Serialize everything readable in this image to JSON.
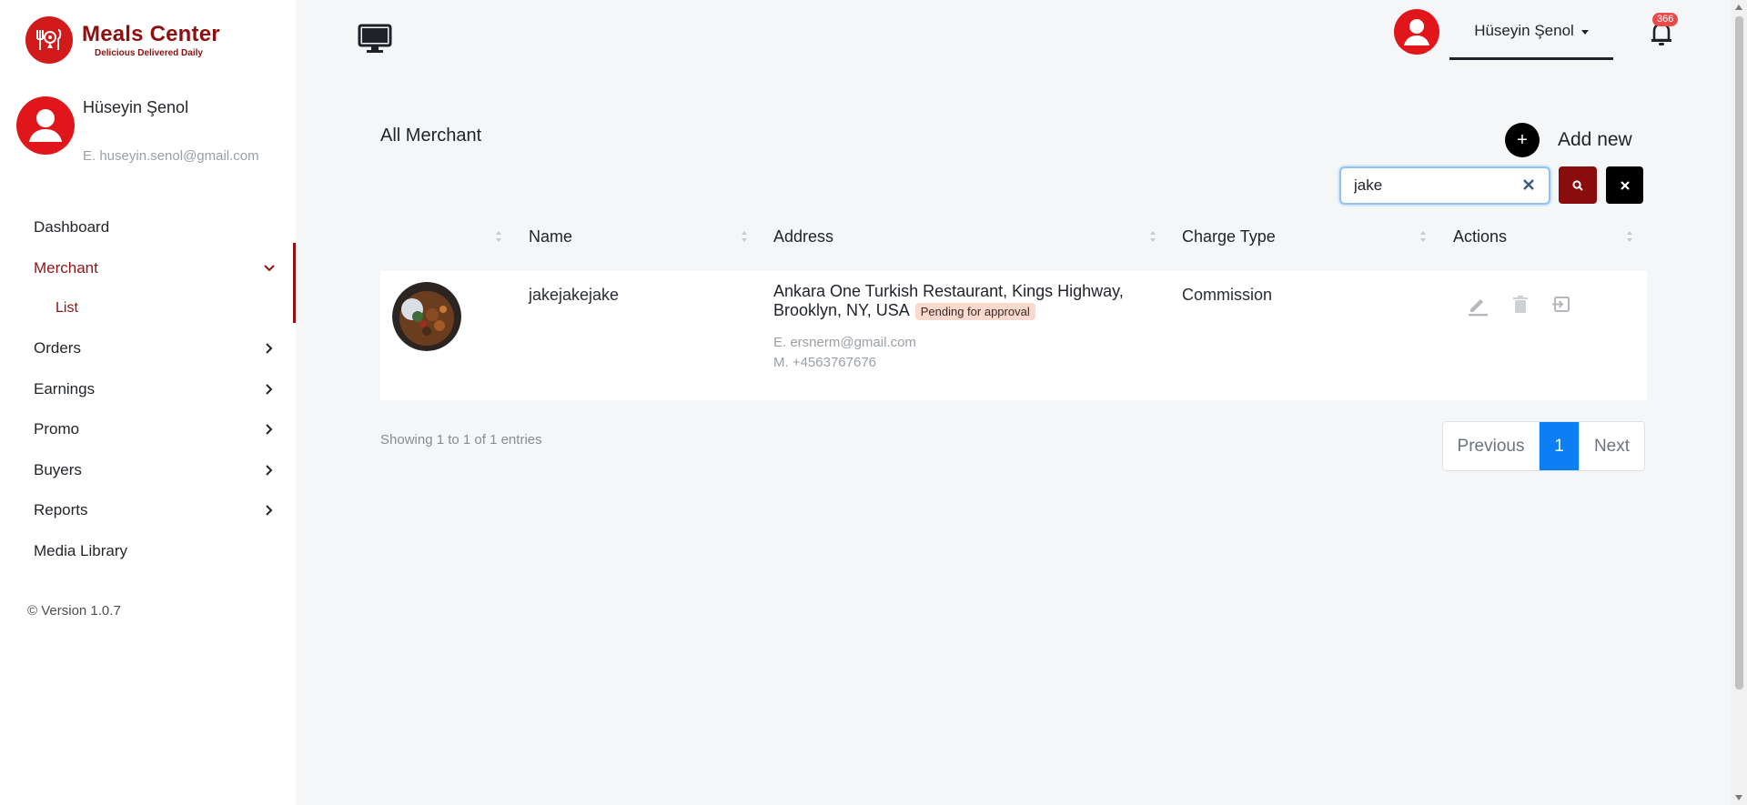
{
  "brand": {
    "name": "Meals Center",
    "tagline": "Delicious Delivered Daily"
  },
  "user": {
    "name": "Hüseyin Şenol",
    "email": "E. huseyin.senol@gmail.com"
  },
  "nav": {
    "dashboard": "Dashboard",
    "merchant": "Merchant",
    "merchant_list": "List",
    "orders": "Orders",
    "earnings": "Earnings",
    "promo": "Promo",
    "buyers": "Buyers",
    "reports": "Reports",
    "media_library": "Media Library"
  },
  "version": "© Version 1.0.7",
  "topbar": {
    "user_name": "Hüseyin Şenol",
    "notification_count": "366"
  },
  "page": {
    "title": "All Merchant",
    "add_new": "Add new"
  },
  "search": {
    "value": "jake"
  },
  "table": {
    "columns": {
      "name": "Name",
      "address": "Address",
      "charge_type": "Charge Type",
      "actions": "Actions"
    },
    "rows": [
      {
        "name": "jakejakejake",
        "address": "Ankara One Turkish Restaurant, Kings Highway, Brooklyn, NY, USA",
        "status": "Pending for approval",
        "email": "E. ersnerm@gmail.com",
        "mobile": "M. +4563767676",
        "charge_type": "Commission"
      }
    ]
  },
  "footer": {
    "entries": "Showing 1 to 1 of 1 entries"
  },
  "pagination": {
    "previous": "Previous",
    "current": "1",
    "next": "Next"
  },
  "colors": {
    "brand_red": "#8e1414",
    "accent_red": "#e0161b",
    "primary_blue": "#0d7ff5",
    "badge_bg": "#fbd9cc"
  }
}
